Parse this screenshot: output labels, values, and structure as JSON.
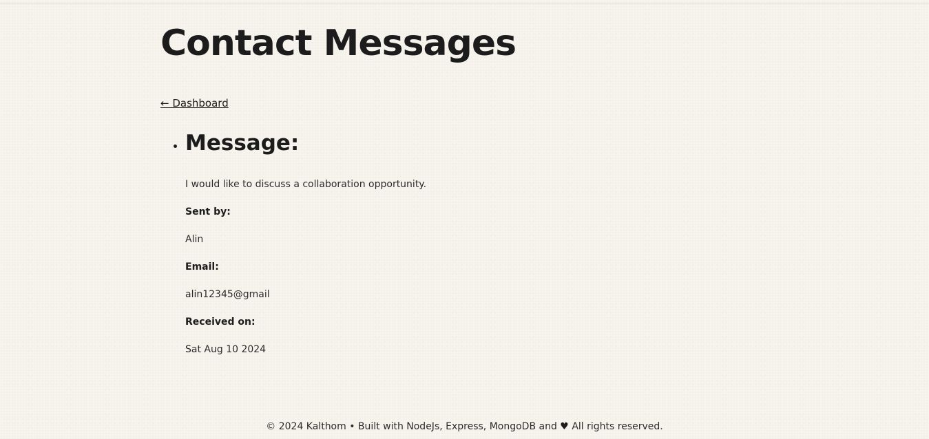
{
  "page": {
    "title": "Contact Messages"
  },
  "nav": {
    "back_label": "← Dashboard"
  },
  "messages": [
    {
      "heading": "Message:",
      "body": "I would like to discuss a collaboration opportunity.",
      "sent_by_label": "Sent by:",
      "sent_by": "Alin",
      "email_label": "Email:",
      "email": "alin12345@gmail",
      "received_label": "Received on:",
      "received_on": "Sat Aug 10 2024"
    }
  ],
  "footer": {
    "prefix": "© 2024 Kalthom • Built with NodeJs, Express, MongoDB and",
    "heart_icon": "heart-icon",
    "suffix": "All rights reserved."
  }
}
